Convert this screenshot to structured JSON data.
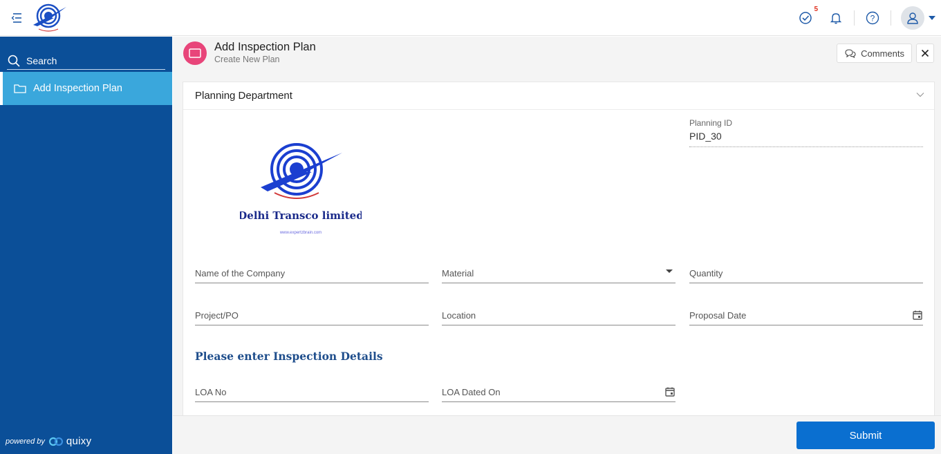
{
  "topbar": {
    "tasks_badge": "5"
  },
  "sidebar": {
    "search_placeholder": "Search",
    "items": [
      {
        "label": "Add Inspection Plan",
        "icon": "folder-icon",
        "active": true
      }
    ],
    "powered_by": "powered by",
    "brand": "quixy"
  },
  "header": {
    "title": "Add Inspection Plan",
    "subtitle": "Create New Plan",
    "comments_label": "Comments"
  },
  "section": {
    "title": "Planning Department"
  },
  "logo": {
    "company": "Delhi Transco limited",
    "website": "www.expertzbrain.com"
  },
  "planning_id": {
    "label": "Planning ID",
    "value": "PID_30"
  },
  "fields": {
    "company_name": "Name of the Company",
    "material": "Material",
    "quantity": "Quantity",
    "project_po": "Project/PO",
    "location": "Location",
    "proposal_date": "Proposal Date",
    "loa_no": "LOA No",
    "loa_dated_on": "LOA Dated On"
  },
  "inspection_section_title": "Please enter Inspection Details",
  "footer": {
    "submit_label": "Submit"
  },
  "colors": {
    "sidebar_bg": "#0b4f98",
    "sidebar_active": "#3aa7dc",
    "submit_bg": "#0a6fd0",
    "form_icon_bg": "#e8457a",
    "section_title": "#1f4e8c"
  }
}
